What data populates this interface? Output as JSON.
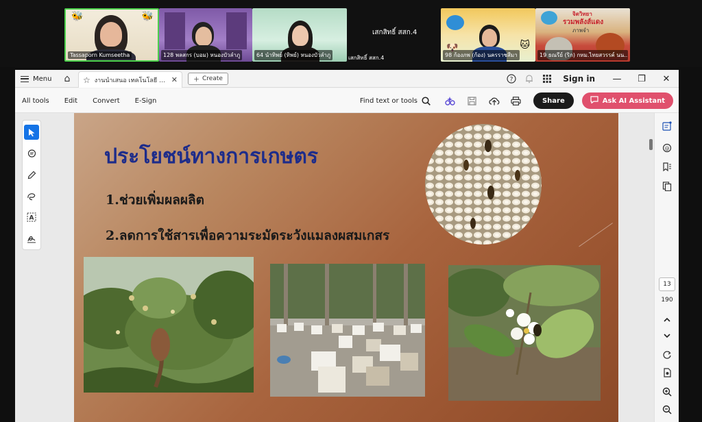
{
  "meeting": {
    "participants": [
      {
        "name": "Tassaporn Kumseetha"
      },
      {
        "name": "128 พลสกร (บอม) หนองบัวลำภู"
      },
      {
        "name": "64 นำทิพย์ (ทิพย์) หนองบัวลำภู"
      },
      {
        "name": "98 ก้องภพ (ก้อง) นครราชสีมา"
      },
      {
        "name": "19 ธณรีย์ (ริก) กทม.ไทยสวรรค์ นน..."
      }
    ],
    "name_only_large": "เสกสิทธิ์ สสก.4",
    "name_only_small": "เสกสิทธิ์ สสก.4",
    "banner_top": "จิตวิทยา",
    "banner_text_1": "รวมพลังส์แดง",
    "banner_text_2": "ภาพจำ"
  },
  "app": {
    "menu_label": "Menu",
    "tab_title": "งานนำเสนอ เทคโนโลยี เทคโนโ...",
    "create_label": "Create",
    "signin_label": "Sign in",
    "tools": [
      "All tools",
      "Edit",
      "Convert",
      "E-Sign"
    ],
    "find_label": "Find text or tools",
    "share_label": "Share",
    "ai_label": "Ask AI Assistant",
    "page_current": "13",
    "page_total": "190"
  },
  "slide": {
    "title": "ประโยชน์ทางการเกษตร",
    "points": [
      "1.ช่วยเพิ่มผลผลิต",
      "2.ลดการใช้สารเพื่อความระมัดระวังแมลงผสมเกสร"
    ]
  },
  "icons": {
    "menu": "hamburger-icon",
    "home": "home-icon",
    "star": "star-icon",
    "close": "close-icon",
    "help": "help-icon",
    "bell": "bell-icon",
    "apps": "apps-grid-icon",
    "search": "search-icon",
    "save": "save-icon",
    "upload": "cloud-upload-icon",
    "print": "print-icon"
  }
}
